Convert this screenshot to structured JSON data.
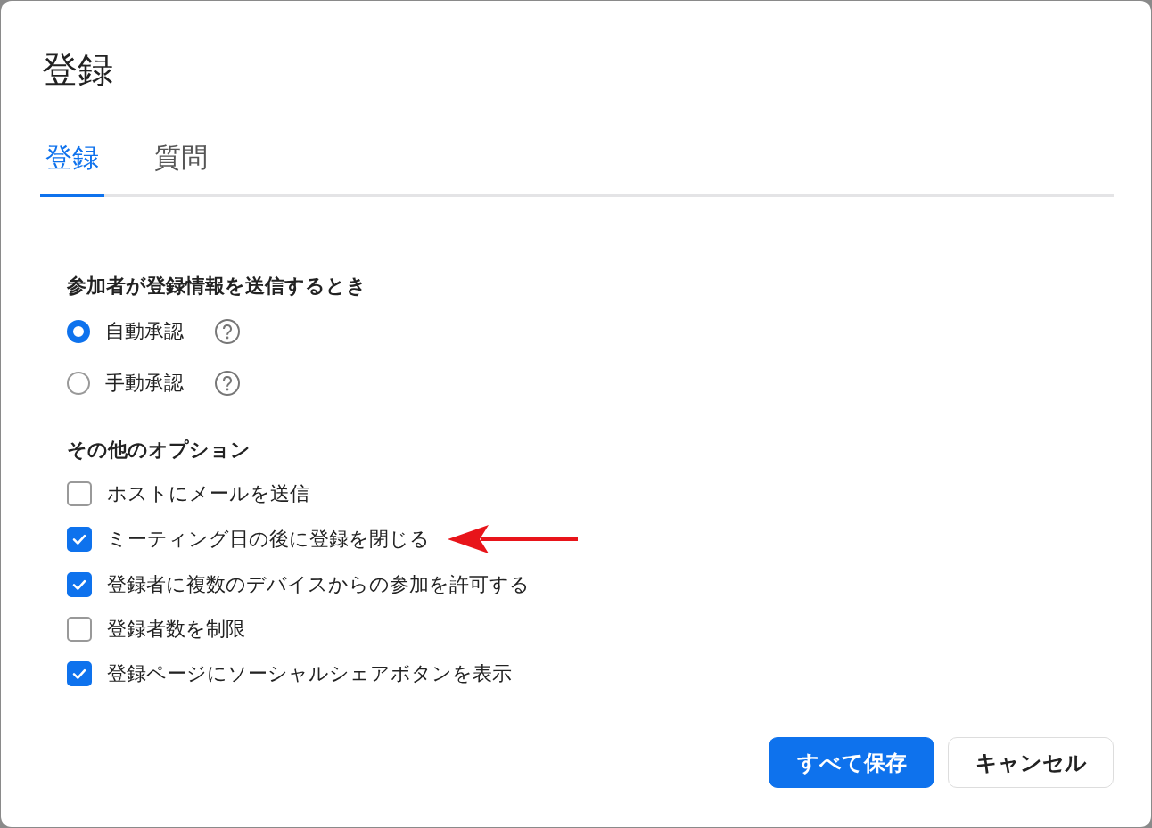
{
  "dialog": {
    "title": "登録"
  },
  "tabs": [
    {
      "label": "登録",
      "selected": true
    },
    {
      "label": "質問",
      "selected": false
    }
  ],
  "approval": {
    "heading": "参加者が登録情報を送信するとき",
    "options": [
      {
        "label": "自動承認",
        "selected": true,
        "help": true
      },
      {
        "label": "手動承認",
        "selected": false,
        "help": true
      }
    ]
  },
  "other_options": {
    "heading": "その他のオプション",
    "options": [
      {
        "label": "ホストにメールを送信",
        "checked": false,
        "pointer": false
      },
      {
        "label": "ミーティング日の後に登録を閉じる",
        "checked": true,
        "pointer": true
      },
      {
        "label": "登録者に複数のデバイスからの参加を許可する",
        "checked": true,
        "pointer": false
      },
      {
        "label": "登録者数を制限",
        "checked": false,
        "pointer": false
      },
      {
        "label": "登録ページにソーシャルシェアボタンを表示",
        "checked": true,
        "pointer": false
      }
    ]
  },
  "buttons": [
    {
      "label": "すべて保存",
      "kind": "primary"
    },
    {
      "label": "キャンセル",
      "kind": "secondary"
    }
  ]
}
